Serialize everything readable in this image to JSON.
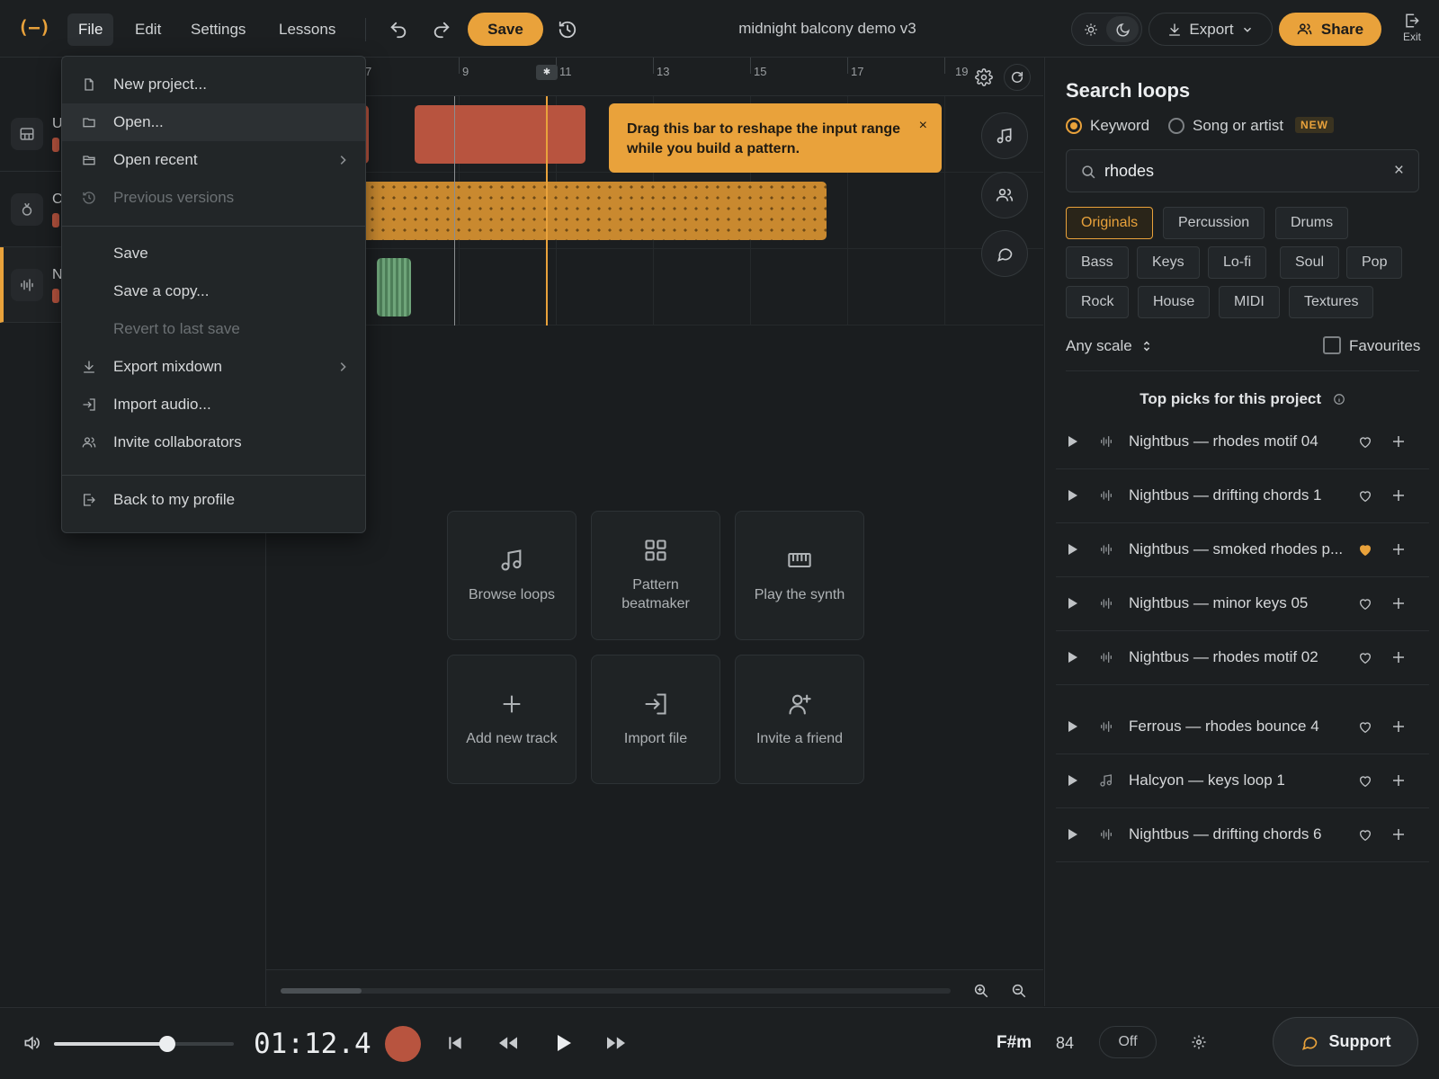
{
  "app": {
    "logo": "(–)",
    "menu": [
      "File",
      "Edit",
      "Settings",
      "Lessons"
    ],
    "save_label": "Save",
    "project_title": "midnight balcony demo v3",
    "export_label": "Export",
    "share_label": "Share",
    "exit_label": "Exit"
  },
  "file_menu": {
    "items": [
      {
        "label": "New project...",
        "icon": "file-icon"
      },
      {
        "label": "Open...",
        "icon": "folder-icon"
      },
      {
        "label": "Open recent",
        "icon": "folder-open-icon"
      },
      {
        "label": "Previous versions",
        "icon": "history-icon"
      },
      {
        "label": "Save"
      },
      {
        "label": "Save a copy..."
      },
      {
        "label": "Revert to last save"
      },
      {
        "label": "Export mixdown",
        "icon": "download-icon"
      },
      {
        "label": "Import audio...",
        "icon": "import-icon"
      },
      {
        "label": "Invite collaborators",
        "icon": "users-icon"
      },
      {
        "label": "Back to my profile",
        "icon": "logout-icon"
      }
    ]
  },
  "tracks": [
    {
      "name": "U",
      "icon": "keyboard-icon"
    },
    {
      "name": "C",
      "icon": "drum-icon"
    },
    {
      "name": "N",
      "icon": "waveform-icon"
    }
  ],
  "ruler": {
    "labels": [
      "7",
      "9",
      "11",
      "13",
      "15",
      "17",
      "19"
    ]
  },
  "tooltip": {
    "text": "Drag this bar to reshape the input range while you build a pattern.",
    "close": "×"
  },
  "tiles": [
    {
      "label": "Browse loops",
      "icon": "music-note-icon"
    },
    {
      "label": "Pattern beatmaker",
      "icon": "grid-icon"
    },
    {
      "label": "Play the synth",
      "icon": "piano-icon"
    },
    {
      "label": "Add new track",
      "icon": "plus-icon"
    },
    {
      "label": "Import file",
      "icon": "import-icon"
    },
    {
      "label": "Invite a friend",
      "icon": "user-plus-icon"
    }
  ],
  "search_panel": {
    "title": "Search loops",
    "mode_keyword": "Keyword",
    "mode_song": "Song or artist",
    "new_badge": "NEW",
    "query": "rhodes",
    "clear": "×",
    "chips": [
      "Originals",
      "Percussion",
      "Drums",
      "Bass",
      "Keys",
      "Lo-fi",
      "Soul",
      "Pop",
      "Rock",
      "House",
      "MIDI",
      "Textures"
    ],
    "active_chip": "Originals",
    "scale": "Any scale",
    "favourites": "Favourites",
    "top_picks": "Top picks for this project",
    "loops": [
      {
        "name": "Nightbus — rhodes motif 04",
        "favourite": false,
        "type": "audio"
      },
      {
        "name": "Nightbus — drifting chords 1",
        "favourite": false,
        "type": "audio"
      },
      {
        "name": "Nightbus — smoked rhodes p...",
        "favourite": true,
        "type": "audio"
      },
      {
        "name": "Nightbus — minor keys 05",
        "favourite": false,
        "type": "audio"
      },
      {
        "name": "Nightbus — rhodes motif 02",
        "favourite": false,
        "type": "audio"
      },
      {
        "name": "Ferrous — rhodes bounce 4",
        "favourite": false,
        "type": "audio"
      },
      {
        "name": "Halcyon — keys loop 1",
        "favourite": false,
        "type": "midi"
      },
      {
        "name": "Nightbus — drifting chords 6",
        "favourite": false,
        "type": "audio"
      }
    ]
  },
  "transport": {
    "volume": 0.63,
    "time": "01:12.4",
    "key": "F#m",
    "bpm": "84",
    "metronome": "Off",
    "support": "Support"
  },
  "colors": {
    "accent": "#e9a23b",
    "clip_red": "#b8543f",
    "background": "#1a1d1f"
  }
}
